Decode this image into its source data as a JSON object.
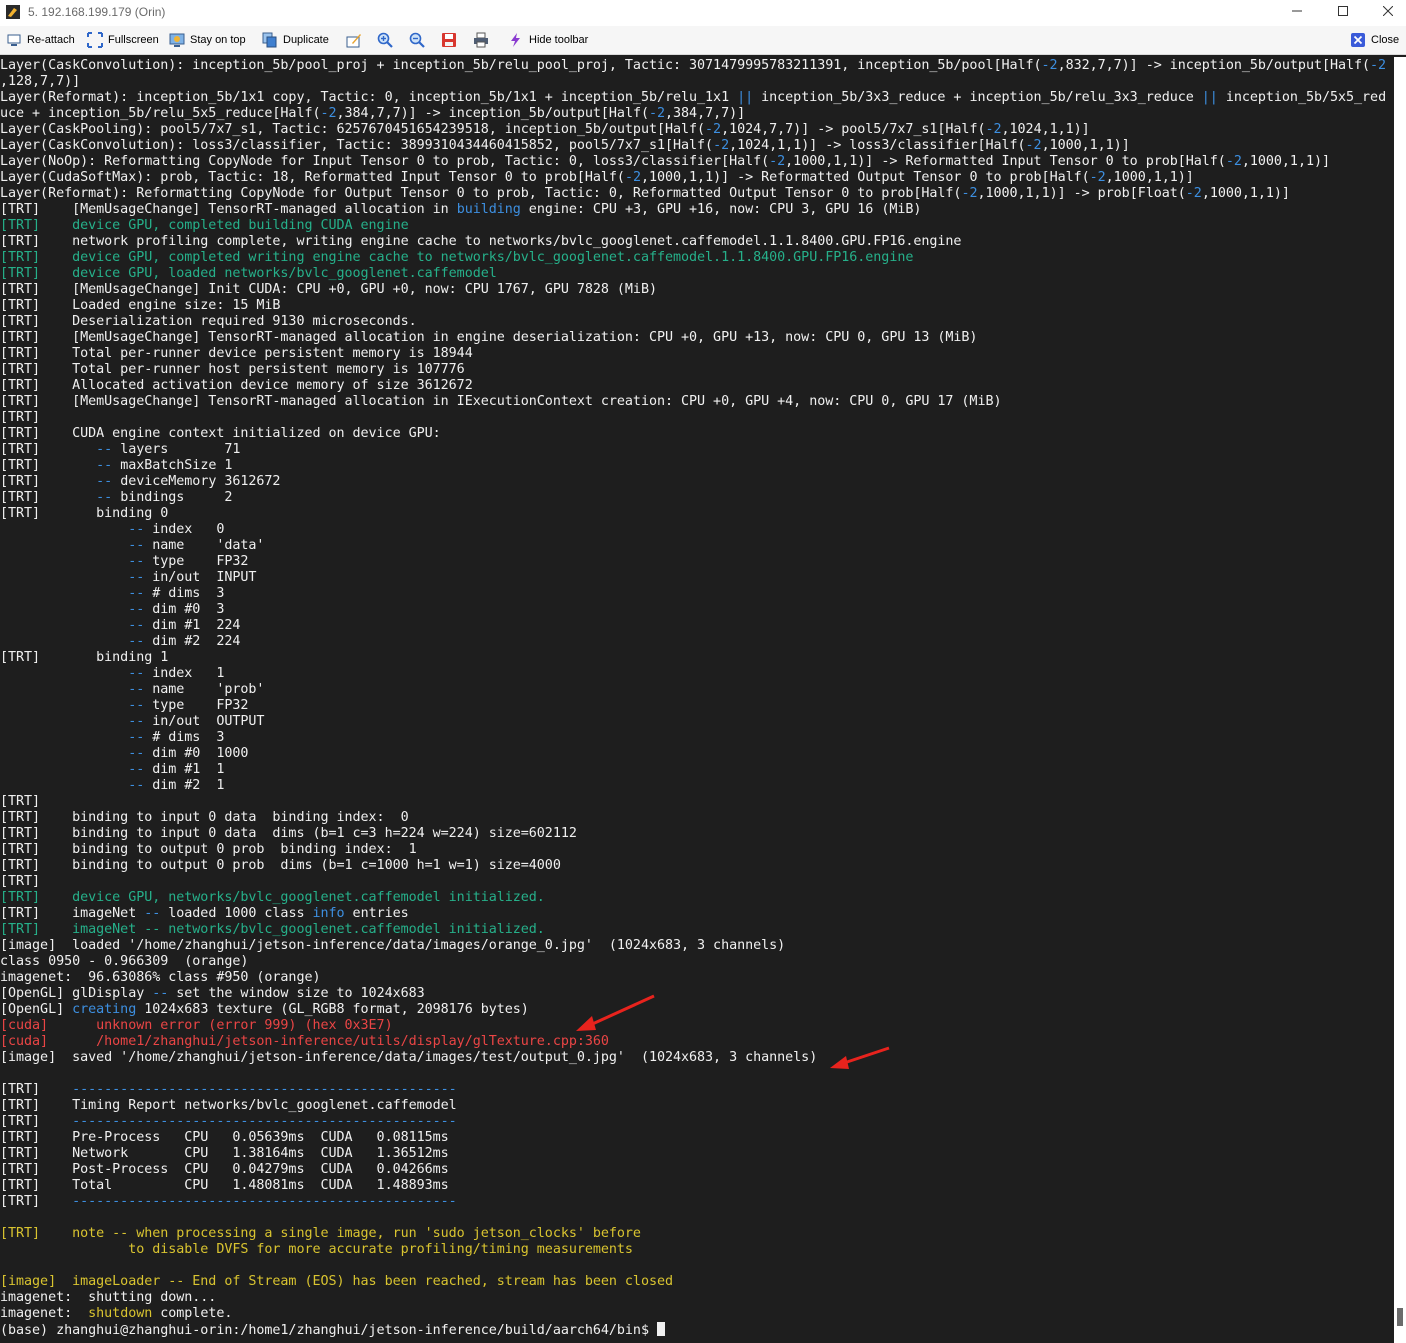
{
  "window": {
    "title": "5. 192.168.199.179 (Orin)"
  },
  "toolbar": {
    "reattach": "Re-attach",
    "fullscreen": "Fullscreen",
    "stay_on_top": "Stay on top",
    "duplicate": "Duplicate",
    "hide_toolbar": "Hide toolbar",
    "close": "Close"
  },
  "colors": {
    "background": "#1e1e1e",
    "text": "#f0f0f0",
    "green": "#26b08a",
    "blue": "#3d8fe0",
    "red": "#ea4545",
    "yellow": "#d9c430",
    "annotation_arrow": "#e8231d"
  },
  "terminal": {
    "lines": [
      [
        [
          "w",
          "Layer(CaskConvolution): inception_5b/pool_proj + inception_5b/relu_pool_proj, Tactic: 3071479995783211391, inception_5b/pool[Half("
        ],
        [
          "b",
          "-2"
        ],
        [
          "w",
          ",832,7,7)] -> inception_5b/output[Half("
        ],
        [
          "b",
          "-2"
        ]
      ],
      [
        [
          "w",
          ",128,7,7)]"
        ]
      ],
      [
        [
          "w",
          "Layer(Reformat): inception_5b/1x1 copy, Tactic: 0, inception_5b/1x1 + inception_5b/relu_1x1 "
        ],
        [
          "b",
          "||"
        ],
        [
          "w",
          " inception_5b/3x3_reduce + inception_5b/relu_3x3_reduce "
        ],
        [
          "b",
          "||"
        ],
        [
          "w",
          " inception_5b/5x5_red"
        ]
      ],
      [
        [
          "w",
          "uce + inception_5b/relu_5x5_reduce[Half("
        ],
        [
          "b",
          "-2"
        ],
        [
          "w",
          ",384,7,7)] -> inception_5b/output[Half("
        ],
        [
          "b",
          "-2"
        ],
        [
          "w",
          ",384,7,7)]"
        ]
      ],
      [
        [
          "w",
          "Layer(CaskPooling): pool5/7x7_s1, Tactic: 6257670451654239518, inception_5b/output[Half("
        ],
        [
          "b",
          "-2"
        ],
        [
          "w",
          ",1024,7,7)] -> pool5/7x7_s1[Half("
        ],
        [
          "b",
          "-2"
        ],
        [
          "w",
          ",1024,1,1)]"
        ]
      ],
      [
        [
          "w",
          "Layer(CaskConvolution): loss3/classifier, Tactic: 3899310434460415852, pool5/7x7_s1[Half("
        ],
        [
          "b",
          "-2"
        ],
        [
          "w",
          ",1024,1,1)] -> loss3/classifier[Half("
        ],
        [
          "b",
          "-2"
        ],
        [
          "w",
          ",1000,1,1)]"
        ]
      ],
      [
        [
          "w",
          "Layer(NoOp): Reformatting CopyNode for Input Tensor 0 to prob, Tactic: 0, loss3/classifier[Half("
        ],
        [
          "b",
          "-2"
        ],
        [
          "w",
          ",1000,1,1)] -> Reformatted Input Tensor 0 to prob[Half("
        ],
        [
          "b",
          "-2"
        ],
        [
          "w",
          ",1000,1,1)]"
        ]
      ],
      [
        [
          "w",
          "Layer(CudaSoftMax): prob, Tactic: 18, Reformatted Input Tensor 0 to prob[Half("
        ],
        [
          "b",
          "-2"
        ],
        [
          "w",
          ",1000,1,1)] -> Reformatted Output Tensor 0 to prob[Half("
        ],
        [
          "b",
          "-2"
        ],
        [
          "w",
          ",1000,1,1)]"
        ]
      ],
      [
        [
          "w",
          "Layer(Reformat): Reformatting CopyNode for Output Tensor 0 to prob, Tactic: 0, Reformatted Output Tensor 0 to prob[Half("
        ],
        [
          "b",
          "-2"
        ],
        [
          "w",
          ",1000,1,1)] -> prob[Float("
        ],
        [
          "b",
          "-2"
        ],
        [
          "w",
          ",1000,1,1)]"
        ]
      ],
      [
        [
          "w",
          "[TRT]    [MemUsageChange] TensorRT-managed allocation in "
        ],
        [
          "b",
          "building"
        ],
        [
          "w",
          " engine: CPU +3, GPU +16, now: CPU 3, GPU 16 (MiB)"
        ]
      ],
      [
        [
          "g",
          "[TRT]    device GPU, completed building CUDA engine"
        ]
      ],
      [
        [
          "w",
          "[TRT]    network profiling complete, writing engine cache to networks/bvlc_googlenet.caffemodel.1.1.8400.GPU.FP16.engine"
        ]
      ],
      [
        [
          "g",
          "[TRT]    device GPU, completed writing engine cache to networks/bvlc_googlenet.caffemodel.1.1.8400.GPU.FP16.engine"
        ]
      ],
      [
        [
          "g",
          "[TRT]    device GPU, loaded networks/bvlc_googlenet.caffemodel"
        ]
      ],
      [
        [
          "w",
          "[TRT]    [MemUsageChange] Init CUDA: CPU +0, GPU +0, now: CPU 1767, GPU 7828 (MiB)"
        ]
      ],
      [
        [
          "w",
          "[TRT]    Loaded engine size: 15 MiB"
        ]
      ],
      [
        [
          "w",
          "[TRT]    Deserialization required 9130 microseconds."
        ]
      ],
      [
        [
          "w",
          "[TRT]    [MemUsageChange] TensorRT-managed allocation in engine deserialization: CPU +0, GPU +13, now: CPU 0, GPU 13 (MiB)"
        ]
      ],
      [
        [
          "w",
          "[TRT]    Total per-runner device persistent memory is 18944"
        ]
      ],
      [
        [
          "w",
          "[TRT]    Total per-runner host persistent memory is 107776"
        ]
      ],
      [
        [
          "w",
          "[TRT]    Allocated activation device memory of size 3612672"
        ]
      ],
      [
        [
          "w",
          "[TRT]    [MemUsageChange] TensorRT-managed allocation in IExecutionContext creation: CPU +0, GPU +4, now: CPU 0, GPU 17 (MiB)"
        ]
      ],
      [
        [
          "w",
          "[TRT]    "
        ]
      ],
      [
        [
          "w",
          "[TRT]    CUDA engine context initialized on device GPU:"
        ]
      ],
      [
        [
          "w",
          "[TRT]       "
        ],
        [
          "b",
          "--"
        ],
        [
          "w",
          " layers       71"
        ]
      ],
      [
        [
          "w",
          "[TRT]       "
        ],
        [
          "b",
          "--"
        ],
        [
          "w",
          " maxBatchSize 1"
        ]
      ],
      [
        [
          "w",
          "[TRT]       "
        ],
        [
          "b",
          "--"
        ],
        [
          "w",
          " deviceMemory 3612672"
        ]
      ],
      [
        [
          "w",
          "[TRT]       "
        ],
        [
          "b",
          "--"
        ],
        [
          "w",
          " bindings     2"
        ]
      ],
      [
        [
          "w",
          "[TRT]       binding 0"
        ]
      ],
      [
        [
          "w",
          "                "
        ],
        [
          "b",
          "--"
        ],
        [
          "w",
          " index   0"
        ]
      ],
      [
        [
          "w",
          "                "
        ],
        [
          "b",
          "--"
        ],
        [
          "w",
          " name    'data'"
        ]
      ],
      [
        [
          "w",
          "                "
        ],
        [
          "b",
          "--"
        ],
        [
          "w",
          " type    FP32"
        ]
      ],
      [
        [
          "w",
          "                "
        ],
        [
          "b",
          "--"
        ],
        [
          "w",
          " in/out  INPUT"
        ]
      ],
      [
        [
          "w",
          "                "
        ],
        [
          "b",
          "--"
        ],
        [
          "w",
          " # dims  3"
        ]
      ],
      [
        [
          "w",
          "                "
        ],
        [
          "b",
          "--"
        ],
        [
          "w",
          " dim #0  3"
        ]
      ],
      [
        [
          "w",
          "                "
        ],
        [
          "b",
          "--"
        ],
        [
          "w",
          " dim #1  224"
        ]
      ],
      [
        [
          "w",
          "                "
        ],
        [
          "b",
          "--"
        ],
        [
          "w",
          " dim #2  224"
        ]
      ],
      [
        [
          "w",
          "[TRT]       binding 1"
        ]
      ],
      [
        [
          "w",
          "                "
        ],
        [
          "b",
          "--"
        ],
        [
          "w",
          " index   1"
        ]
      ],
      [
        [
          "w",
          "                "
        ],
        [
          "b",
          "--"
        ],
        [
          "w",
          " name    'prob'"
        ]
      ],
      [
        [
          "w",
          "                "
        ],
        [
          "b",
          "--"
        ],
        [
          "w",
          " type    FP32"
        ]
      ],
      [
        [
          "w",
          "                "
        ],
        [
          "b",
          "--"
        ],
        [
          "w",
          " in/out  OUTPUT"
        ]
      ],
      [
        [
          "w",
          "                "
        ],
        [
          "b",
          "--"
        ],
        [
          "w",
          " # dims  3"
        ]
      ],
      [
        [
          "w",
          "                "
        ],
        [
          "b",
          "--"
        ],
        [
          "w",
          " dim #0  1000"
        ]
      ],
      [
        [
          "w",
          "                "
        ],
        [
          "b",
          "--"
        ],
        [
          "w",
          " dim #1  1"
        ]
      ],
      [
        [
          "w",
          "                "
        ],
        [
          "b",
          "--"
        ],
        [
          "w",
          " dim #2  1"
        ]
      ],
      [
        [
          "w",
          "[TRT]    "
        ]
      ],
      [
        [
          "w",
          "[TRT]    binding to input 0 data  binding index:  0"
        ]
      ],
      [
        [
          "w",
          "[TRT]    binding to input 0 data  dims (b=1 c=3 h=224 w=224) size=602112"
        ]
      ],
      [
        [
          "w",
          "[TRT]    binding to output 0 prob  binding index:  1"
        ]
      ],
      [
        [
          "w",
          "[TRT]    binding to output 0 prob  dims (b=1 c=1000 h=1 w=1) size=4000"
        ]
      ],
      [
        [
          "w",
          "[TRT]    "
        ]
      ],
      [
        [
          "g",
          "[TRT]    device GPU, networks/bvlc_googlenet.caffemodel initialized."
        ]
      ],
      [
        [
          "w",
          "[TRT]    imageNet "
        ],
        [
          "b",
          "--"
        ],
        [
          "w",
          " loaded 1000 class "
        ],
        [
          "b",
          "info"
        ],
        [
          "w",
          " entries"
        ]
      ],
      [
        [
          "g",
          "[TRT]    imageNet -- networks/bvlc_googlenet.caffemodel initialized."
        ]
      ],
      [
        [
          "w",
          "[image]  loaded '/home/zhanghui/jetson-inference/data/images/orange_0.jpg'  (1024x683, 3 channels)"
        ]
      ],
      [
        [
          "w",
          "class 0950 - 0.966309  (orange)"
        ]
      ],
      [
        [
          "w",
          "imagenet:  96.63086% class #950 (orange)"
        ]
      ],
      [
        [
          "w",
          "[OpenGL] glDisplay "
        ],
        [
          "b",
          "--"
        ],
        [
          "w",
          " set the window size to 1024x683"
        ]
      ],
      [
        [
          "w",
          "[OpenGL] "
        ],
        [
          "b",
          "creating"
        ],
        [
          "w",
          " 1024x683 texture (GL_RGB8 format, 2098176 bytes)"
        ]
      ],
      [
        [
          "r",
          "[cuda]      unknown error (error 999) (hex 0x3E7)"
        ]
      ],
      [
        [
          "r",
          "[cuda]      /home1/zhanghui/jetson-inference/utils/display/glTexture.cpp:360"
        ]
      ],
      [
        [
          "w",
          "[image]  saved '/home/zhanghui/jetson-inference/data/images/test/output_0.jpg'  (1024x683, 3 channels)"
        ]
      ],
      [
        [
          "w",
          ""
        ]
      ],
      [
        [
          "w",
          "[TRT]    "
        ],
        [
          "b",
          "------------------------------------------------"
        ]
      ],
      [
        [
          "w",
          "[TRT]    Timing Report networks/bvlc_googlenet.caffemodel"
        ]
      ],
      [
        [
          "w",
          "[TRT]    "
        ],
        [
          "b",
          "------------------------------------------------"
        ]
      ],
      [
        [
          "w",
          "[TRT]    Pre-Process   CPU   0.05639ms  CUDA   0.08115ms"
        ]
      ],
      [
        [
          "w",
          "[TRT]    Network       CPU   1.38164ms  CUDA   1.36512ms"
        ]
      ],
      [
        [
          "w",
          "[TRT]    Post-Process  CPU   0.04279ms  CUDA   0.04266ms"
        ]
      ],
      [
        [
          "w",
          "[TRT]    Total         CPU   1.48081ms  CUDA   1.48893ms"
        ]
      ],
      [
        [
          "w",
          "[TRT]    "
        ],
        [
          "b",
          "------------------------------------------------"
        ]
      ],
      [
        [
          "w",
          ""
        ]
      ],
      [
        [
          "y",
          "[TRT]    note -- when processing a single image, run 'sudo jetson_clocks' before"
        ]
      ],
      [
        [
          "y",
          "                to disable DVFS for more accurate profiling/timing measurements"
        ]
      ],
      [
        [
          "w",
          ""
        ]
      ],
      [
        [
          "y",
          "[image]  imageLoader -- End of Stream (EOS) has been reached, stream has been closed"
        ]
      ],
      [
        [
          "w",
          "imagenet:  shutting down..."
        ]
      ],
      [
        [
          "w",
          "imagenet:  "
        ],
        [
          "y",
          "shutdown"
        ],
        [
          "w",
          " complete."
        ]
      ],
      [
        [
          "w",
          "(base) zhanghui@zhanghui-orin:/home1/zhanghui/jetson-inference/build/aarch64/bin$ "
        ]
      ]
    ]
  }
}
